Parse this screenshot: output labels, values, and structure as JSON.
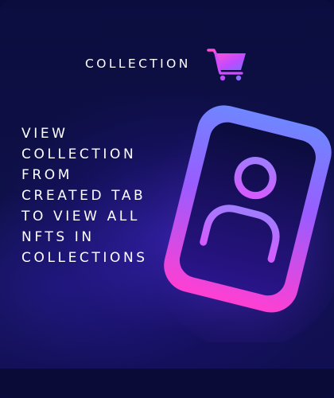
{
  "header": {
    "title": "COLLECTION",
    "icon": "shopping-cart-icon"
  },
  "body": {
    "lines": [
      "VIEW",
      "COLLECTION",
      "FROM",
      "CREATED TAB",
      "TO VIEW ALL",
      "NFTS IN",
      "COLLECTIONS"
    ]
  },
  "illustration": {
    "icon": "user-profile-icon"
  },
  "colors": {
    "background": "#0c0d3f",
    "accent_pink": "#ff3fd0",
    "accent_purple": "#8a5cff",
    "accent_blue": "#6a7cff",
    "text": "#ffffff"
  }
}
